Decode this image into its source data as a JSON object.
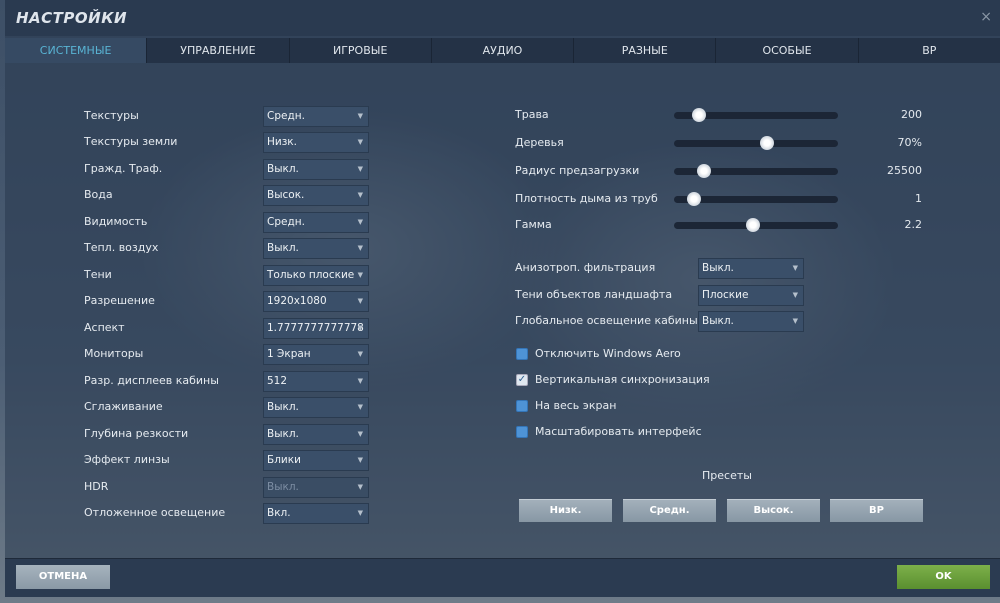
{
  "window": {
    "title": "НАСТРОЙКИ",
    "close_icon": "×"
  },
  "tabs": [
    "СИСТЕМНЫЕ",
    "УПРАВЛЕНИЕ",
    "ИГРОВЫЕ",
    "АУДИО",
    "РАЗНЫЕ",
    "ОСОБЫЕ",
    "ВР"
  ],
  "active_tab": 0,
  "left_settings": [
    {
      "label": "Текстуры",
      "value": "Средн."
    },
    {
      "label": "Текстуры земли",
      "value": "Низк."
    },
    {
      "label": "Гражд. Траф.",
      "value": "Выкл."
    },
    {
      "label": "Вода",
      "value": "Высок."
    },
    {
      "label": "Видимость",
      "value": "Средн."
    },
    {
      "label": "Тепл. воздух",
      "value": "Выкл."
    },
    {
      "label": "Тени",
      "value": "Только плоские"
    },
    {
      "label": "Разрешение",
      "value": "1920x1080"
    },
    {
      "label": "Аспект",
      "value": "1.7777777777778"
    },
    {
      "label": "Мониторы",
      "value": "1 Экран"
    },
    {
      "label": "Разр. дисплеев кабины",
      "value": "512"
    },
    {
      "label": "Сглаживание",
      "value": "Выкл."
    },
    {
      "label": "Глубина резкости",
      "value": "Выкл."
    },
    {
      "label": "Эффект линзы",
      "value": "Блики"
    },
    {
      "label": "HDR",
      "value": "Выкл.",
      "disabled": true
    },
    {
      "label": "Отложенное освещение",
      "value": "Вкл."
    }
  ],
  "sliders": [
    {
      "label": "Трава",
      "value": "200",
      "level": 0.15
    },
    {
      "label": "Деревья",
      "value": "70%",
      "level": 0.57
    },
    {
      "label": "Радиус предзагрузки",
      "value": "25500",
      "level": 0.18
    },
    {
      "label": "Плотность дыма из труб",
      "value": "1",
      "level": 0.12
    },
    {
      "label": "Гамма",
      "value": "2.2",
      "level": 0.48
    }
  ],
  "right_selects": [
    {
      "label": "Анизотроп. фильтрация",
      "value": "Выкл."
    },
    {
      "label": "Тени объектов ландшафта",
      "value": "Плоские"
    },
    {
      "label": "Глобальное освещение кабины",
      "value": "Выкл."
    }
  ],
  "checkboxes": [
    {
      "label": "Отключить Windows Aero",
      "checked": false
    },
    {
      "label": "Вертикальная синхронизация",
      "checked": true
    },
    {
      "label": "На весь экран",
      "checked": false
    },
    {
      "label": "Масштабировать интерфейс",
      "checked": false
    }
  ],
  "presets": {
    "label": "Пресеты",
    "buttons": [
      "Низк.",
      "Средн.",
      "Высок.",
      "ВР"
    ]
  },
  "footer": {
    "cancel": "ОТМЕНА",
    "ok": "OK"
  },
  "colors": {
    "active_tab": "#59b4d4",
    "ok_button": "#6a9e3a",
    "checkbox": "#4e93d6"
  }
}
